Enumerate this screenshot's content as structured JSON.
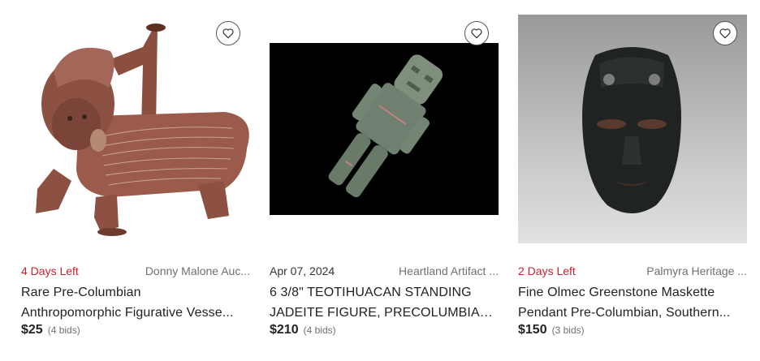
{
  "lots": [
    {
      "time_left": "4 Days Left",
      "auction_house": "Donny Malone Auc...",
      "title_line1": "Rare Pre-Columbian",
      "title_line2": "Anthropomorphic Figurative Vesse...",
      "price": "$25",
      "bids": "(4 bids)",
      "image": "pre-columbian-figurative-vessel",
      "time_color": "#c8202f"
    },
    {
      "time_left": "Apr 07, 2024",
      "auction_house": "Heartland Artifact ...",
      "title_line1": "6 3/8\" TEOTIHUACAN STANDING",
      "title_line2": "JADEITE FIGURE, PRECOLUMBIAN...",
      "price": "$210",
      "bids": "(4 bids)",
      "image": "jadeite-figure-on-black",
      "time_color": "#333333"
    },
    {
      "time_left": "2 Days Left",
      "auction_house": "Palmyra Heritage ...",
      "title_line1": "Fine Olmec Greenstone Maskette",
      "title_line2": "Pendant Pre-Columbian, Southern...",
      "price": "$150",
      "bids": "(3 bids)",
      "image": "greenstone-maskette",
      "time_color": "#c8202f"
    }
  ],
  "icons": {
    "favorite": "heart-outline-icon"
  }
}
